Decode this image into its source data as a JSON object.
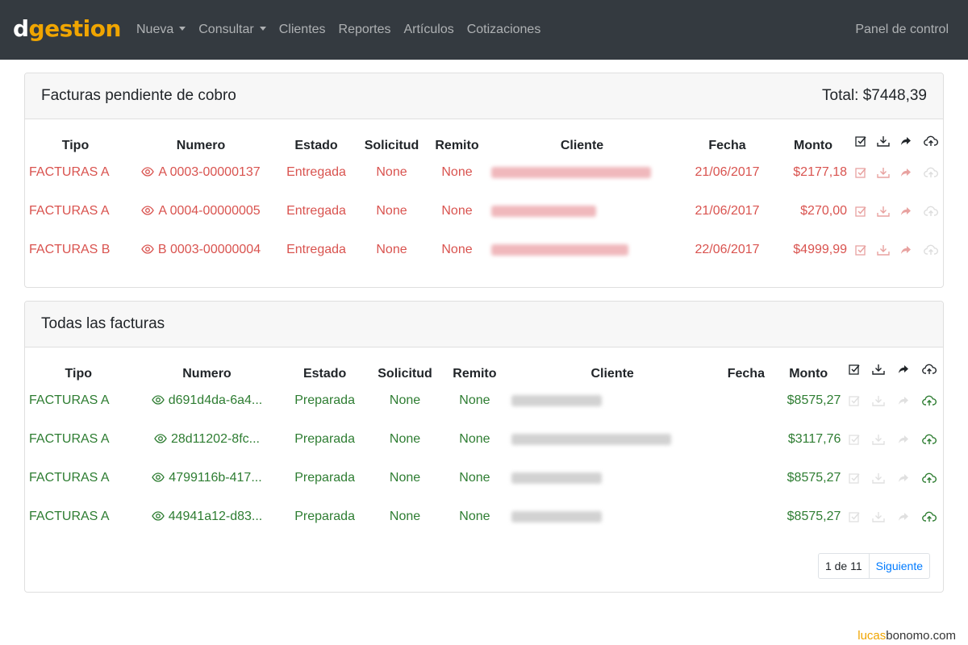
{
  "navbar": {
    "brand_d": "d",
    "brand_rest": "gestion",
    "items": [
      {
        "label": "Nueva",
        "dropdown": true
      },
      {
        "label": "Consultar",
        "dropdown": true
      },
      {
        "label": "Clientes",
        "dropdown": false
      },
      {
        "label": "Reportes",
        "dropdown": false
      },
      {
        "label": "Artículos",
        "dropdown": false
      },
      {
        "label": "Cotizaciones",
        "dropdown": false
      }
    ],
    "right_label": "Panel de control"
  },
  "pending": {
    "title": "Facturas pendiente de cobro",
    "total": "Total: $7448,39",
    "columns": [
      "Tipo",
      "Numero",
      "Estado",
      "Solicitud",
      "Remito",
      "Cliente",
      "Fecha",
      "Monto"
    ],
    "rows": [
      {
        "tipo": "FACTURAS A",
        "numero": "A 0003-00000137",
        "estado": "Entregada",
        "solicitud": "None",
        "remito": "None",
        "fecha": "21/06/2017",
        "monto": "$2177,18"
      },
      {
        "tipo": "FACTURAS A",
        "numero": "A 0004-00000005",
        "estado": "Entregada",
        "solicitud": "None",
        "remito": "None",
        "fecha": "21/06/2017",
        "monto": "$270,00"
      },
      {
        "tipo": "FACTURAS B",
        "numero": "B 0003-00000004",
        "estado": "Entregada",
        "solicitud": "None",
        "remito": "None",
        "fecha": "22/06/2017",
        "monto": "$4999,99"
      }
    ]
  },
  "all": {
    "title": "Todas las facturas",
    "columns": [
      "Tipo",
      "Numero",
      "Estado",
      "Solicitud",
      "Remito",
      "Cliente",
      "Fecha",
      "Monto"
    ],
    "rows": [
      {
        "tipo": "FACTURAS A",
        "numero": "d691d4da-6a4...",
        "estado": "Preparada",
        "solicitud": "None",
        "remito": "None",
        "fecha": "",
        "monto": "$8575,27"
      },
      {
        "tipo": "FACTURAS A",
        "numero": "28d11202-8fc...",
        "estado": "Preparada",
        "solicitud": "None",
        "remito": "None",
        "fecha": "",
        "monto": "$3117,76"
      },
      {
        "tipo": "FACTURAS A",
        "numero": "4799116b-417...",
        "estado": "Preparada",
        "solicitud": "None",
        "remito": "None",
        "fecha": "",
        "monto": "$8575,27"
      },
      {
        "tipo": "FACTURAS A",
        "numero": "44941a12-d83...",
        "estado": "Preparada",
        "solicitud": "None",
        "remito": "None",
        "fecha": "",
        "monto": "$8575,27"
      }
    ],
    "pagination": {
      "current": "1 de 11",
      "next": "Siguiente"
    }
  },
  "footer": {
    "part1": "lucas",
    "part2": "bonomo.com"
  },
  "colors": {
    "navbar": "#343a40",
    "brand_accent": "#f0a500",
    "pending_text": "#d9534f",
    "prepared_text": "#2e7d32",
    "link": "#007bff"
  },
  "icons": [
    "eye-icon",
    "check-square-icon",
    "download-icon",
    "share-icon",
    "cloud-upload-icon",
    "chevron-down-icon"
  ]
}
